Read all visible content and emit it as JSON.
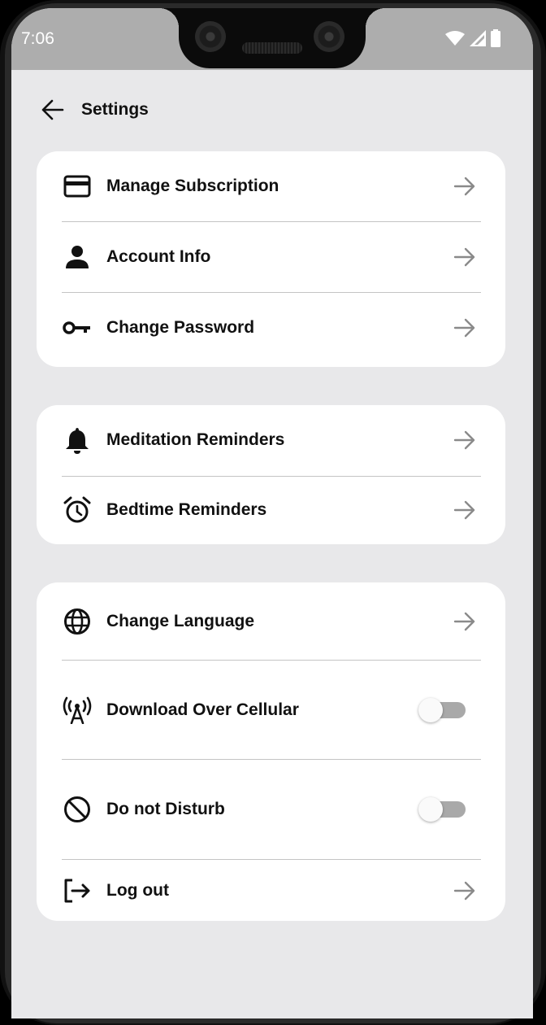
{
  "status_bar": {
    "time": "7:06"
  },
  "header": {
    "title": "Settings"
  },
  "groups": [
    {
      "items": [
        {
          "label": "Manage Subscription",
          "icon": "credit-card-icon",
          "control": "arrow"
        },
        {
          "label": "Account Info",
          "icon": "person-icon",
          "control": "arrow"
        },
        {
          "label": "Change Password",
          "icon": "key-icon",
          "control": "arrow"
        }
      ]
    },
    {
      "items": [
        {
          "label": "Meditation Reminders",
          "icon": "bell-icon",
          "control": "arrow"
        },
        {
          "label": "Bedtime Reminders",
          "icon": "alarm-clock-icon",
          "control": "arrow"
        }
      ]
    },
    {
      "items": [
        {
          "label": "Change Language",
          "icon": "globe-icon",
          "control": "arrow"
        },
        {
          "label": "Download Over Cellular",
          "icon": "cell-tower-icon",
          "control": "toggle",
          "enabled": false
        },
        {
          "label": "Do not Disturb",
          "icon": "do-not-disturb-icon",
          "control": "toggle",
          "enabled": false
        },
        {
          "label": "Log out",
          "icon": "logout-icon",
          "control": "arrow"
        }
      ]
    }
  ],
  "colors": {
    "background": "#e8e8ea",
    "card": "#ffffff",
    "status_bar": "#adadad",
    "arrow": "#8a8a8a",
    "toggle_track": "#a9a9a9"
  }
}
